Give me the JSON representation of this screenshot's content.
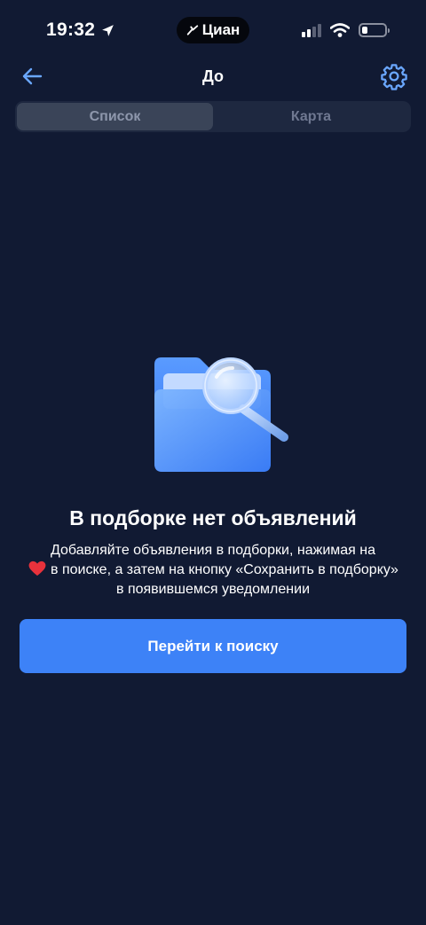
{
  "status_bar": {
    "time": "19:32",
    "island_app": "Циан"
  },
  "nav": {
    "title": "До",
    "back_icon": "arrow-left-icon",
    "settings_icon": "gear-icon"
  },
  "tabs": [
    {
      "label": "Список",
      "active": true
    },
    {
      "label": "Карта",
      "active": false
    }
  ],
  "empty_state": {
    "title": "В подборке нет объявлений",
    "desc_part1": "Добавляйте объявления в подборки, нажимая на",
    "desc_part2": "в поиске, а затем на кнопку «Сохранить в подборку» в появившемся уведомлении",
    "illustration_icon": "folder-search-icon",
    "heart_icon": "heart-icon"
  },
  "primary_button": {
    "label": "Перейти к поиску"
  },
  "colors": {
    "background": "#111a33",
    "accent": "#3d82f7",
    "icon_blue": "#6aa7ff",
    "heart_red": "#e8323c"
  }
}
